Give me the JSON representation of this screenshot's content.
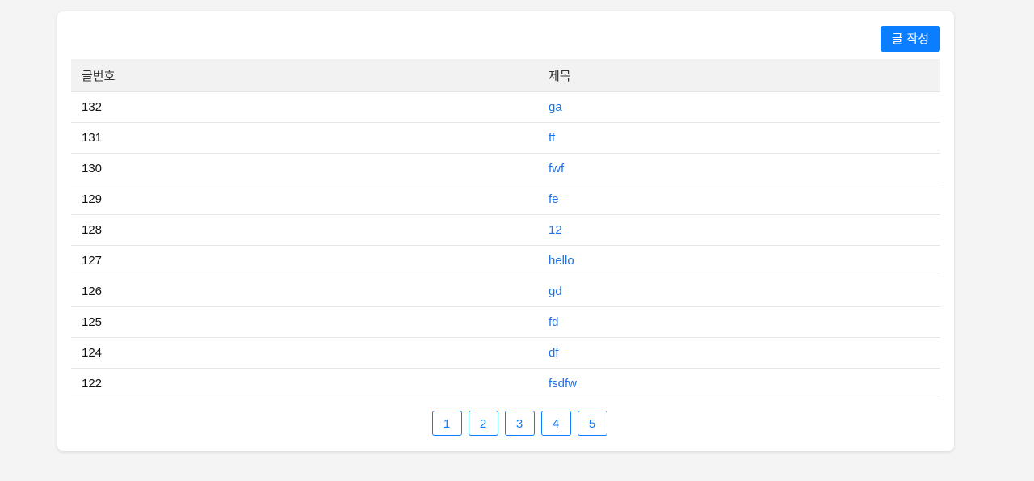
{
  "toolbar": {
    "write_label": "글 작성"
  },
  "table": {
    "headers": [
      "글번호",
      "제목"
    ],
    "rows": [
      {
        "no": "132",
        "title": "ga"
      },
      {
        "no": "131",
        "title": "ff"
      },
      {
        "no": "130",
        "title": "fwf"
      },
      {
        "no": "129",
        "title": "fe"
      },
      {
        "no": "128",
        "title": "12"
      },
      {
        "no": "127",
        "title": "hello"
      },
      {
        "no": "126",
        "title": "gd"
      },
      {
        "no": "125",
        "title": "fd"
      },
      {
        "no": "124",
        "title": "df"
      },
      {
        "no": "122",
        "title": "fsdfw"
      }
    ]
  },
  "pagination": {
    "pages": [
      "1",
      "2",
      "3",
      "4",
      "5"
    ]
  },
  "colors": {
    "accent": "#0b7dff",
    "link": "#1a73e8",
    "header_bg": "#f2f2f2",
    "page_bg": "#f4f4f4"
  }
}
